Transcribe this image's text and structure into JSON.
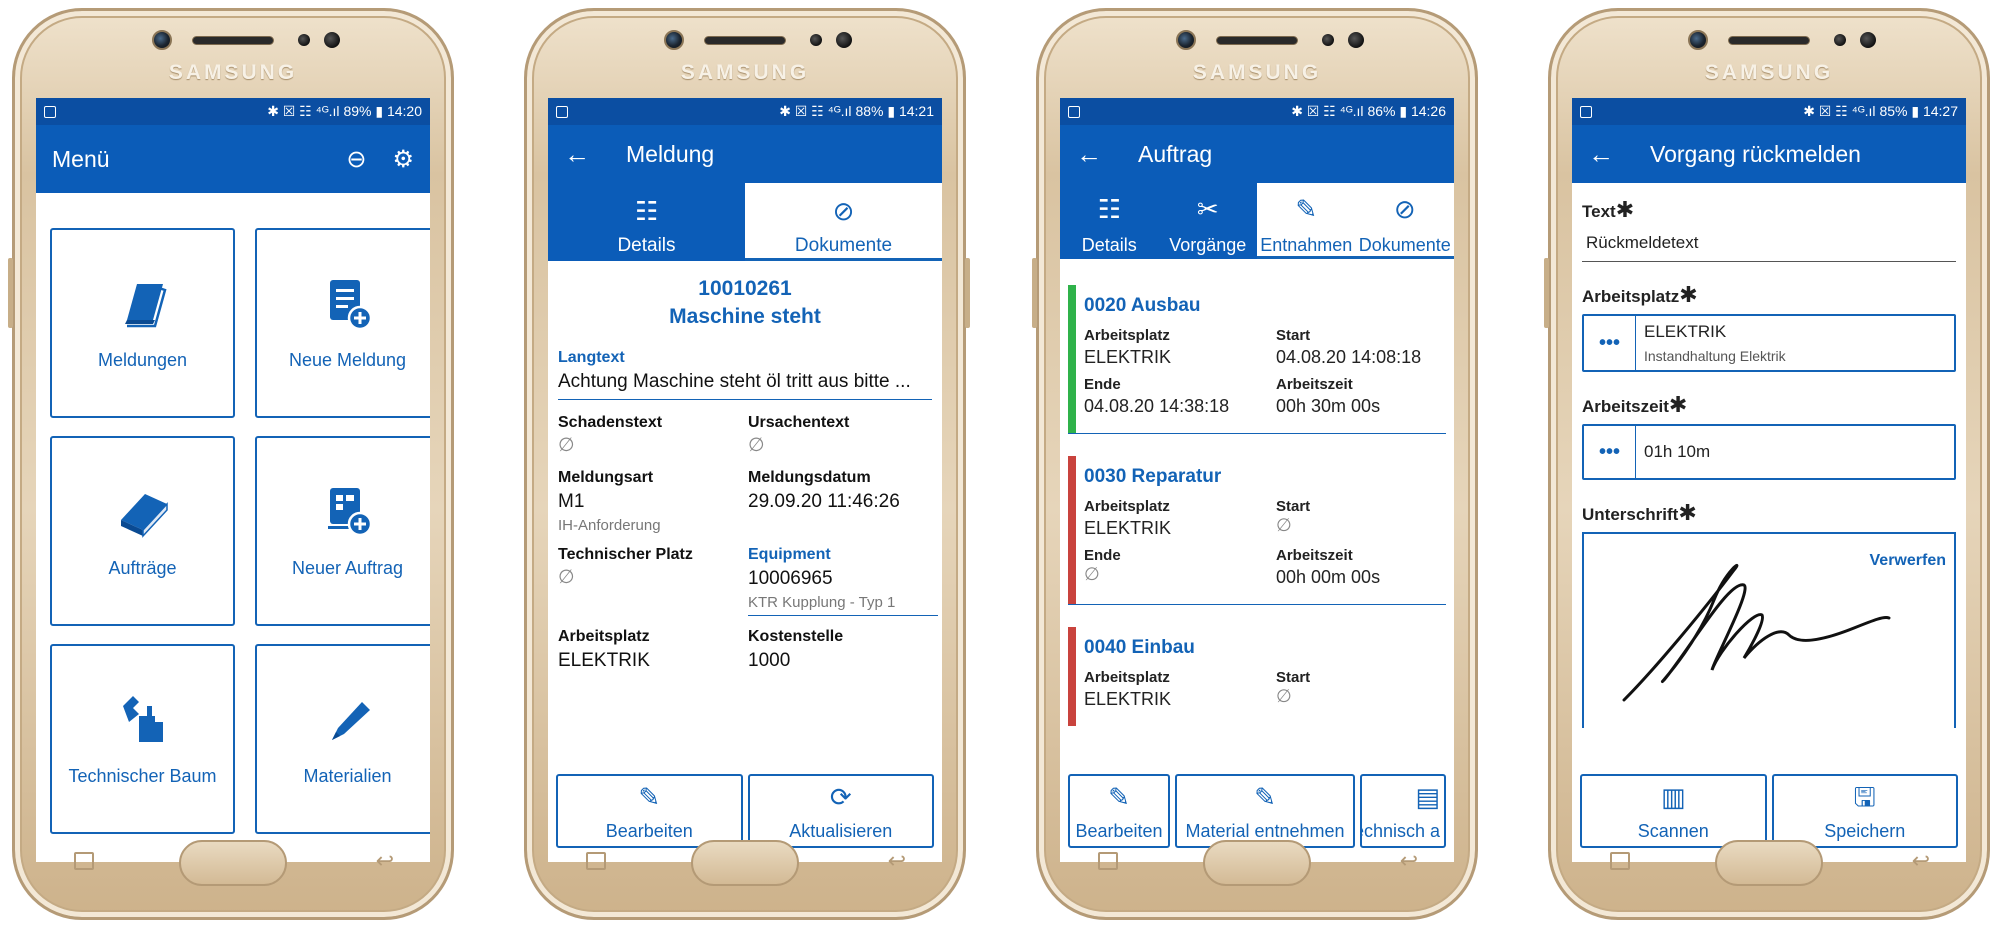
{
  "device": {
    "brand": "SAMSUNG",
    "accent": "#0b5cb8",
    "status_bar": "#0b4ea2",
    "ok_color": "#2fb24a",
    "warn_color": "#c9433d"
  },
  "screen1": {
    "status": {
      "icons": "✱ ☒ ☷ ⁴ᴳ.ıl",
      "battery": "89%",
      "time": "14:20"
    },
    "title": "Menü",
    "tiles": [
      {
        "label": "Meldungen",
        "icon": "book-icon"
      },
      {
        "label": "Neue Meldung",
        "icon": "new-notification-icon"
      },
      {
        "label": "Aufträge",
        "icon": "closed-book-icon"
      },
      {
        "label": "Neuer Auftrag",
        "icon": "new-order-icon"
      },
      {
        "label": "Technischer Baum",
        "icon": "tools-icon"
      },
      {
        "label": "Materialien",
        "icon": "pen-icon"
      }
    ]
  },
  "screen2": {
    "status": {
      "icons": "✱ ☒ ☷ ⁴ᴳ.ıl",
      "battery": "88%",
      "time": "14:21"
    },
    "title": "Meldung",
    "tabs": [
      "Details",
      "Dokumente"
    ],
    "number": "10010261",
    "headline": "Maschine steht",
    "langtext_label": "Langtext",
    "langtext_value": "Achtung Maschine steht öl tritt aus bitte ...",
    "empty_symbol": "∅",
    "fields": {
      "schadentext": "Schadenstext",
      "ursachentext": "Ursachentext",
      "meldungsart": "Meldungsart",
      "meldungsart_value": "M1",
      "meldungsart_sub": "IH-Anforderung",
      "meldungsdatum": "Meldungsdatum",
      "meldungsdatum_value": "29.09.20 11:46:26",
      "tech_platz": "Technischer Platz",
      "equipment": "Equipment",
      "equipment_value": "10006965",
      "equipment_sub": "KTR Kupplung - Typ 1",
      "arbeitsplatz": "Arbeitsplatz",
      "arbeitsplatz_value": "ELEKTRIK",
      "kostenstelle": "Kostenstelle",
      "kostenstelle_value": "1000"
    },
    "buttons": [
      "Bearbeiten",
      "Aktualisieren"
    ]
  },
  "screen3": {
    "status": {
      "icons": "✱ ☒ ☷ ⁴ᴳ.ıl",
      "battery": "86%",
      "time": "14:26"
    },
    "title": "Auftrag",
    "tabs": [
      "Details",
      "Vorgänge",
      "Entnahmen",
      "Dokumente"
    ],
    "labels": {
      "arbeitsplatz": "Arbeitsplatz",
      "start": "Start",
      "ende": "Ende",
      "arbeitszeit": "Arbeitszeit"
    },
    "empty_symbol": "∅",
    "operations": [
      {
        "title": "0020 Ausbau",
        "arbeitsplatz": "ELEKTRIK",
        "start": "04.08.20 14:08:18",
        "ende": "04.08.20 14:38:18",
        "arbeitszeit": "00h 30m 00s",
        "status": "ok"
      },
      {
        "title": "0030 Reparatur",
        "arbeitsplatz": "ELEKTRIK",
        "start": "",
        "ende": "",
        "arbeitszeit": "00h 00m 00s",
        "status": "open"
      },
      {
        "title": "0040 Einbau",
        "arbeitsplatz": "ELEKTRIK",
        "start": "",
        "status": "open"
      }
    ],
    "buttons": [
      "Bearbeiten",
      "Material entnehmen",
      "Technisch a"
    ]
  },
  "screen4": {
    "status": {
      "icons": "✱ ☒ ☷ ⁴ᴳ.ıl",
      "battery": "85%",
      "time": "14:27"
    },
    "title": "Vorgang rückmelden",
    "star": "✱",
    "text_label": "Text",
    "text_value": "Rückmeldetext",
    "arbeitsplatz_label": "Arbeitsplatz",
    "arbeitsplatz_value": "ELEKTRIK",
    "arbeitsplatz_sub": "Instandhaltung Elektrik",
    "arbeitszeit_label": "Arbeitszeit",
    "arbeitszeit_value": "01h 10m",
    "dots": "•••",
    "unterschrift_label": "Unterschrift",
    "discard": "Verwerfen",
    "buttons": [
      "Scannen",
      "Speichern"
    ]
  }
}
